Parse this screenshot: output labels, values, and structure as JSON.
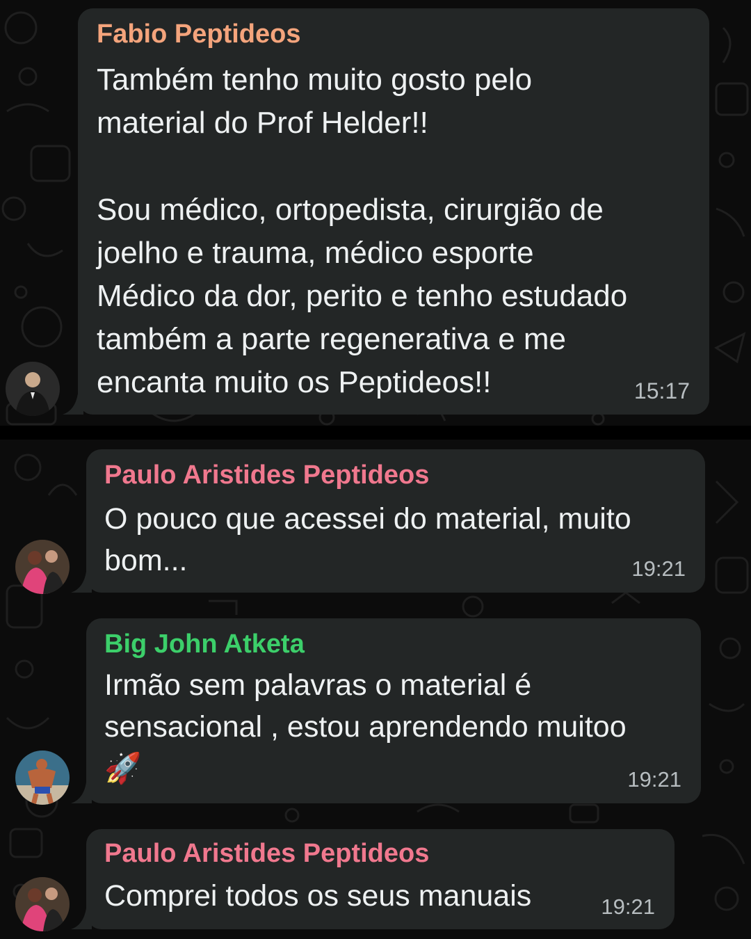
{
  "messages": [
    {
      "sender": "Fabio Peptideos",
      "sender_color": "#f4a47c",
      "text": "Também tenho muito gosto pelo\nmaterial do Prof Helder!!\n\nSou médico, ortopedista, cirurgião de\njoelho e trauma, médico esporte\nMédico da dor, perito e tenho estudado\ntambém a parte regenerativa e me\nencanta muito os Peptideos!!",
      "time": "15:17"
    },
    {
      "sender": "Paulo Aristides Peptideos",
      "sender_color": "#f0788e",
      "text": "O pouco que acessei do material, muito\nbom...",
      "time": "19:21"
    },
    {
      "sender": "Big John Atketa",
      "sender_color": "#3ccf6a",
      "text": "Irmão sem palavras o material é\nsensacional , estou aprendendo muitoo\n🚀",
      "time": "19:21"
    },
    {
      "sender": "Paulo Aristides Peptideos",
      "sender_color": "#f0788e",
      "text": "Comprei todos os seus manuais",
      "time": "19:21"
    }
  ],
  "colors": {
    "bubble": "#232626",
    "background": "#0c0c0c",
    "text": "#e9edef",
    "timestamp": "#b7bdc0"
  },
  "icons": [
    "avatar-fabio",
    "avatar-paulo",
    "avatar-bigjohn",
    "rocket-emoji"
  ]
}
